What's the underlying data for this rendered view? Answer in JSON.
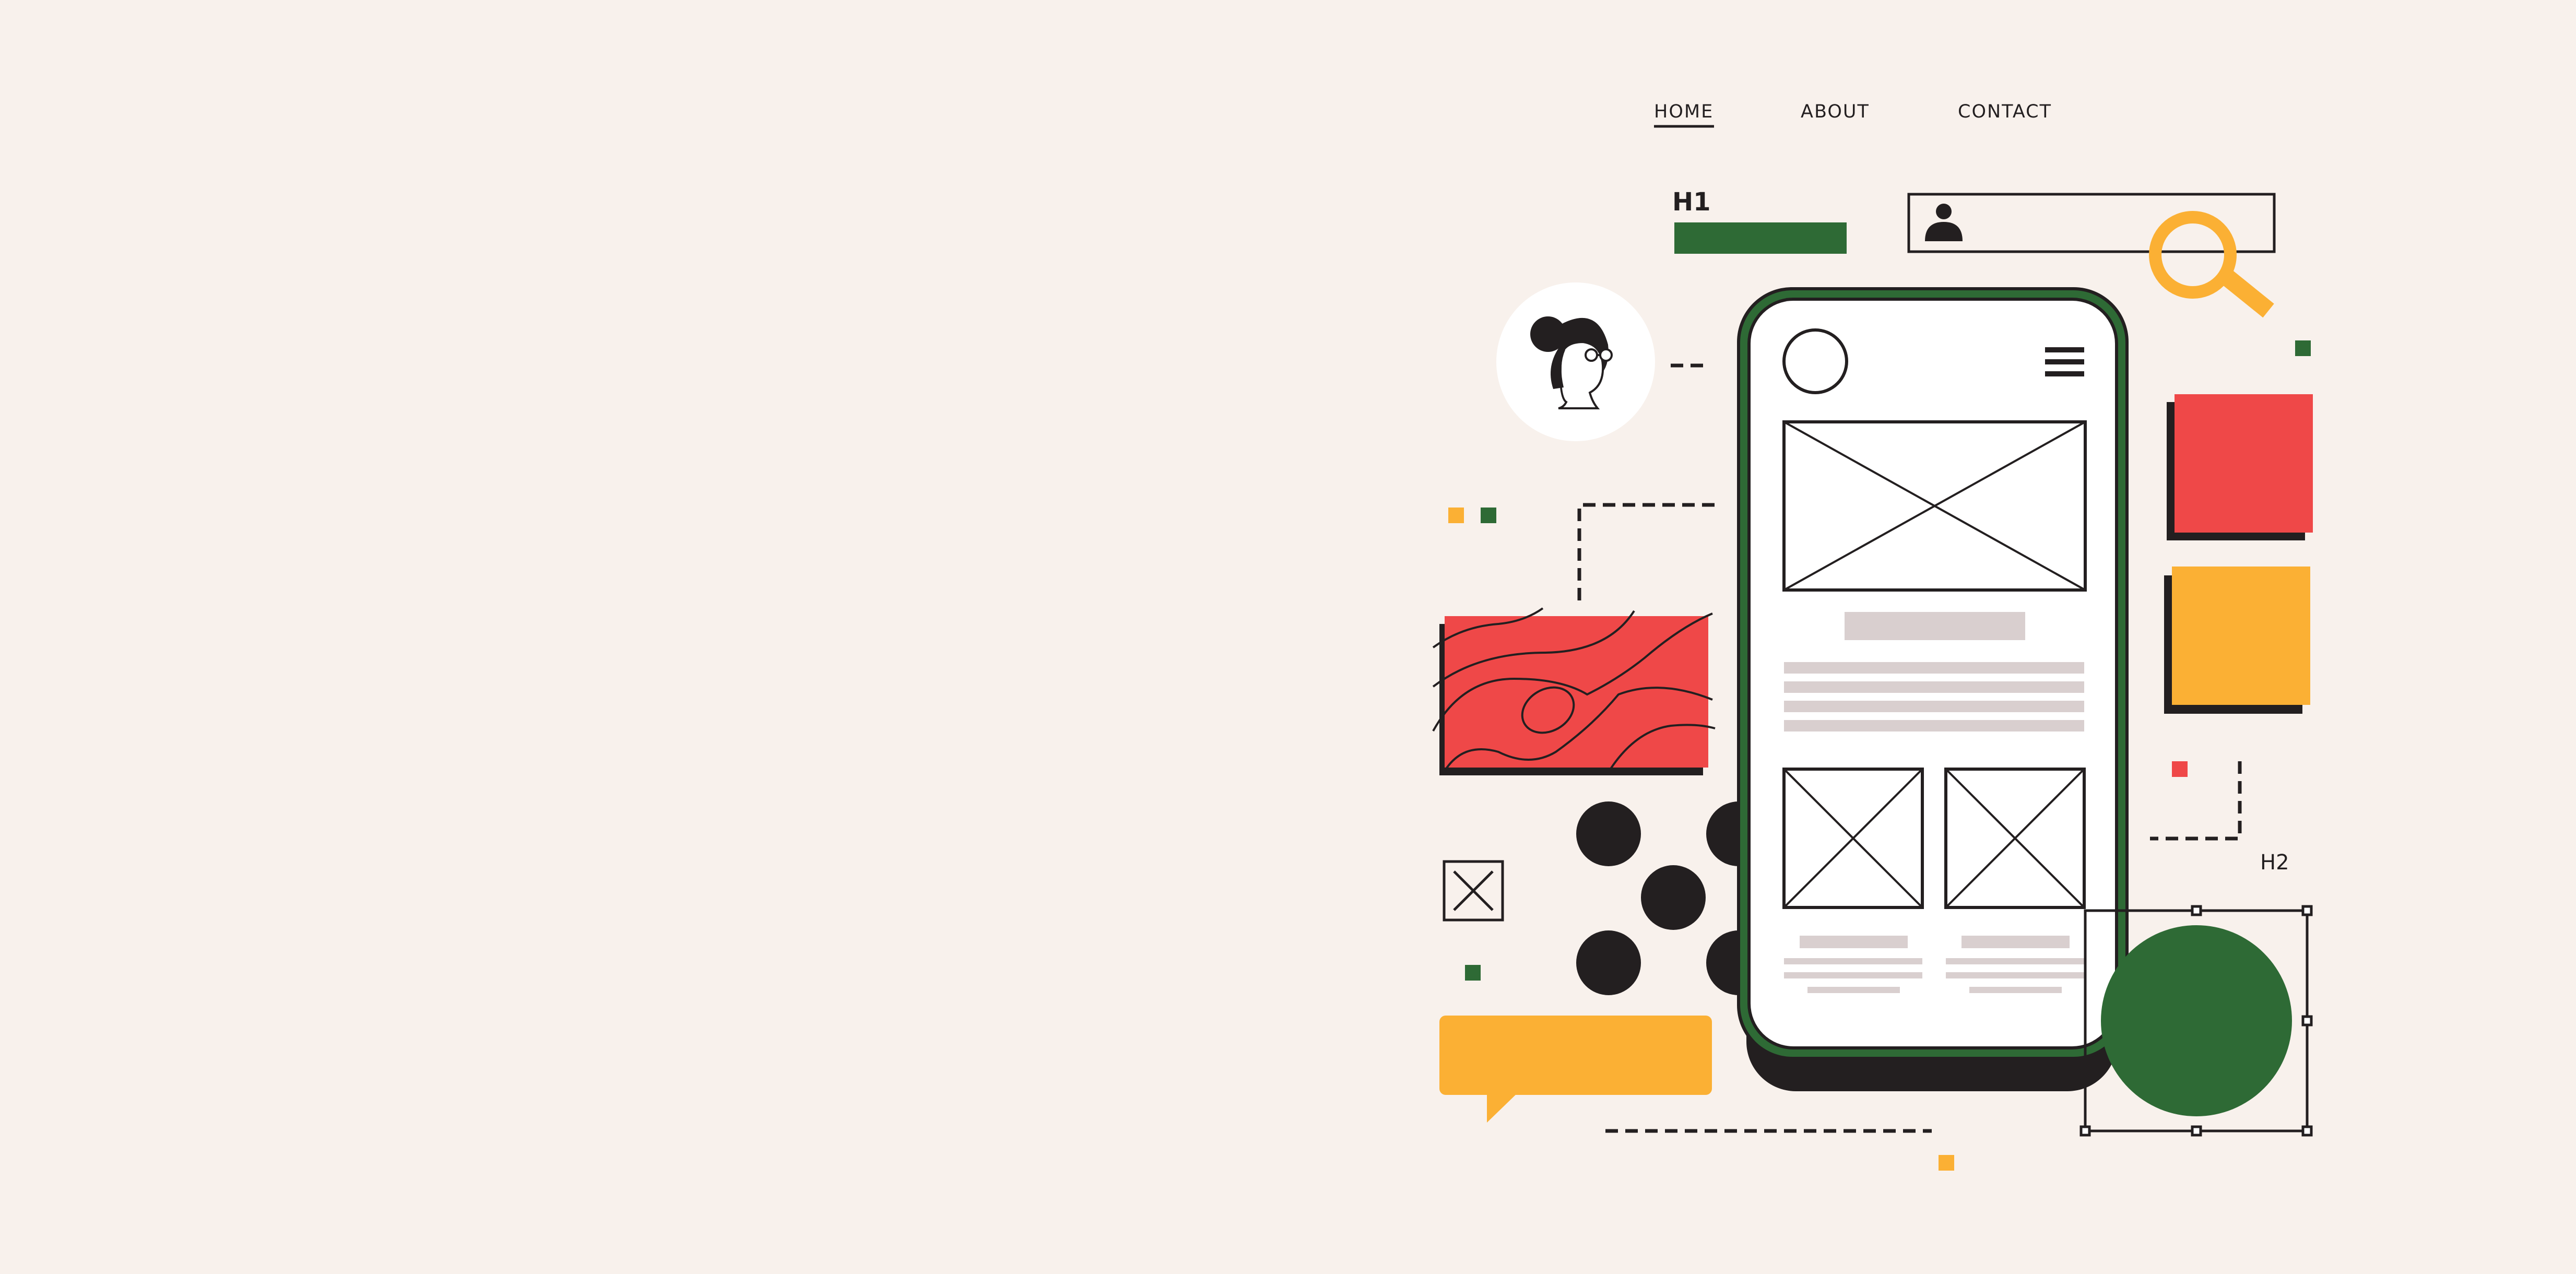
{
  "nav": {
    "items": [
      {
        "label": "HOME",
        "active": true
      },
      {
        "label": "ABOUT",
        "active": false
      },
      {
        "label": "CONTACT",
        "active": false
      }
    ]
  },
  "labels": {
    "h1": "H1",
    "h2": "H2"
  },
  "colors": {
    "background": "#f8f1ec",
    "ink": "#231f20",
    "green": "#2e6a35",
    "red": "#ef4848",
    "yellow": "#fbb034",
    "placeholder": "#d9cfcf",
    "white": "#ffffff"
  },
  "icons": {
    "search": "magnifier-icon",
    "user": "user-icon",
    "menu": "hamburger-icon",
    "avatar": "woman-with-glasses-avatar"
  }
}
